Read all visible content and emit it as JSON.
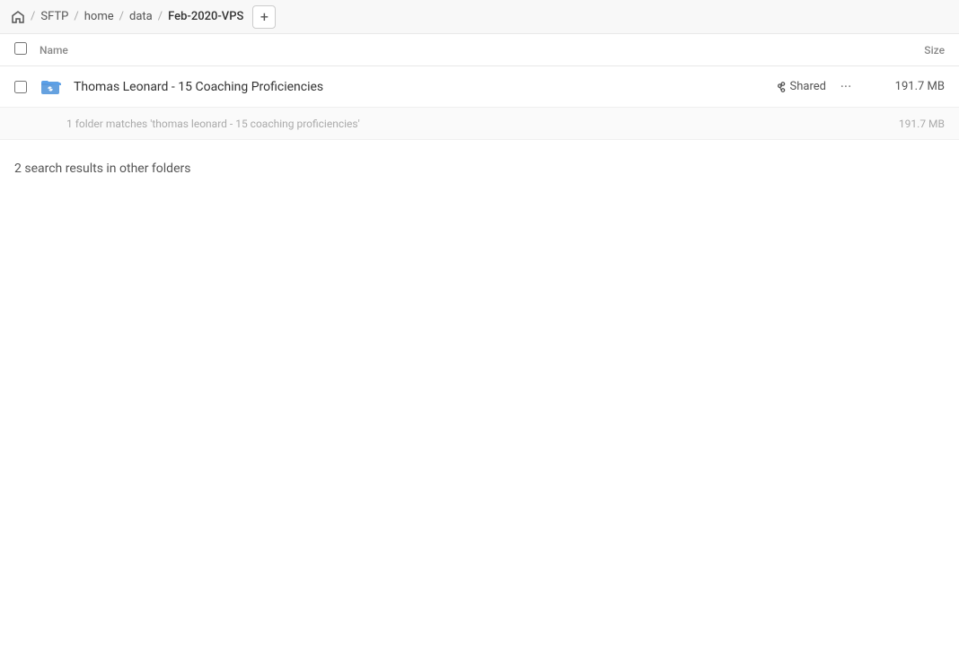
{
  "breadcrumb": {
    "home_label": "home",
    "items": [
      {
        "label": "SFTP",
        "active": false
      },
      {
        "label": "home",
        "active": false
      },
      {
        "label": "data",
        "active": false
      },
      {
        "label": "Feb-2020-VPS",
        "active": true
      }
    ],
    "add_button": "+"
  },
  "columns": {
    "name_label": "Name",
    "size_label": "Size"
  },
  "file_row": {
    "name": "Thomas Leonard - 15 Coaching Proficiencies",
    "shared_label": "Shared",
    "size": "191.7 MB",
    "more_icon": "···"
  },
  "sub_info": {
    "text": "1 folder matches 'thomas leonard - 15 coaching proficiencies'",
    "size": "191.7 MB"
  },
  "search_results": {
    "label": "2 search results in other folders"
  },
  "icons": {
    "home": "🏠",
    "link": "🔗"
  }
}
